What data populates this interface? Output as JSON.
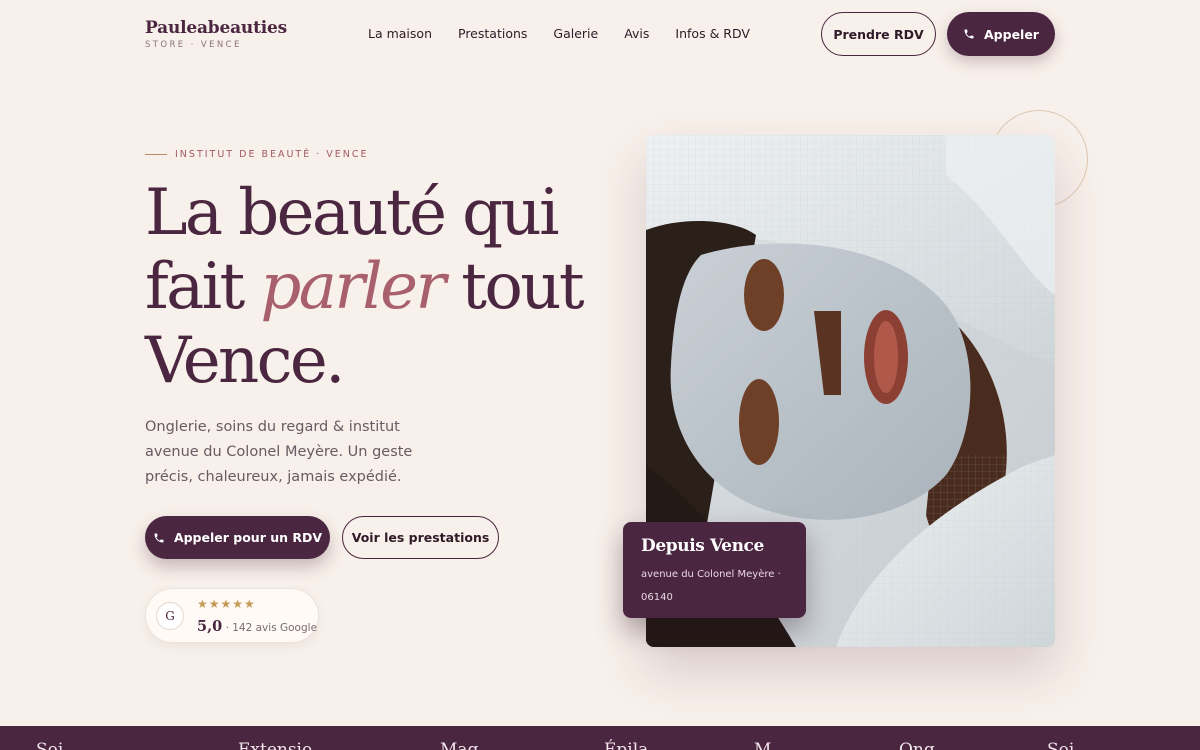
{
  "brand": {
    "name": "Pauleabeauties",
    "tagline": "STORE · VENCE"
  },
  "nav": {
    "items": [
      "La maison",
      "Prestations",
      "Galerie",
      "Avis",
      "Infos & RDV"
    ]
  },
  "header_actions": {
    "rdv_label": "Prendre RDV",
    "call_label": "Appeler"
  },
  "hero": {
    "eyebrow": "INSTITUT DE BEAUTÉ · VENCE",
    "headline": {
      "line1": "La beauté qui",
      "line2_before": "fait ",
      "line2_accent": "parler",
      "line2_after": " tout",
      "line3": "Vence."
    },
    "intro": "Onglerie, soins du regard & institut avenue du Colonel Meyère. Un geste précis, chaleureux, jamais expédié.",
    "cta_call": "Appeler pour un RDV",
    "cta_services": "Voir les prestations",
    "review": {
      "badge_letter": "G",
      "stars": "★★★★★",
      "score": "5,0",
      "count_text": " · 142 avis Google"
    }
  },
  "since_card": {
    "title": "Depuis Vence",
    "address": "avenue du Colonel Meyère · 06140"
  },
  "marquee": {
    "items": [
      "Soi",
      "",
      "Extensio",
      "Maq",
      "Épila",
      "M",
      "Ong",
      "Soi"
    ]
  },
  "colors": {
    "background": "#f8f0ea",
    "primary": "#4a2640",
    "accent": "#a8606c",
    "star": "#c49a55"
  },
  "icons": {
    "phone": "phone-icon",
    "google": "google-g-icon"
  }
}
